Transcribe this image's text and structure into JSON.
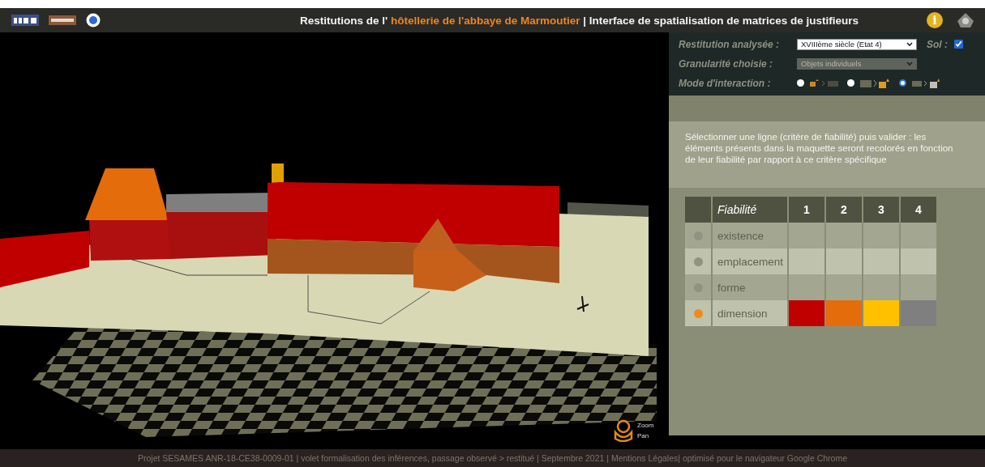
{
  "header": {
    "title_start": "Restitutions de l' ",
    "title_highlight": "hôtellerie de l'abbaye de Marmoutier",
    "title_end": " | Interface de spatialisation de matrices de justifieurs",
    "info_label": "i"
  },
  "controls": {
    "restitution": {
      "label": "Restitution analysée :",
      "value": "XVIIIème siècle (Etat 4)"
    },
    "sol": {
      "label": "Sol :",
      "checked": true
    },
    "granularite": {
      "label": "Granularité choisie :",
      "value": "Objets individuels",
      "disabled": true
    },
    "mode": {
      "label": "Mode d'interaction :",
      "options": [
        {
          "kind": "model-to-matrix",
          "selected": false
        },
        {
          "kind": "matrix-to-model",
          "selected": false
        },
        {
          "kind": "list-to-model",
          "selected": true
        }
      ]
    }
  },
  "instructions": "Sélectionner une ligne (critère de fiabilité) puis valider : les éléments présents dans la maquette seront recolorés en fonction de leur fiabilité par rapport à ce critère spécifique",
  "table": {
    "header": "Fiabilité",
    "levels": [
      {
        "label": "1",
        "color": "#c00000"
      },
      {
        "label": "2",
        "color": "#e46c0a"
      },
      {
        "label": "3",
        "color": "#ffc000"
      },
      {
        "label": "4",
        "color": "#7f7f7f"
      }
    ],
    "rows": [
      {
        "label": "existence",
        "selected": false
      },
      {
        "label": "emplacement",
        "selected": false
      },
      {
        "label": "forme",
        "selected": false
      },
      {
        "label": "dimension",
        "selected": true
      }
    ]
  },
  "viewer": {
    "zoom_label": "Zoom",
    "pan_label": "Pan"
  },
  "footer": "Projet SESAMES ANR-18-CE38-0009-01 | volet formalisation des inférences, passage observé > restitué | Septembre 2021 | Mentions Légales| optimisé pour le navigateur Google Chrome"
}
